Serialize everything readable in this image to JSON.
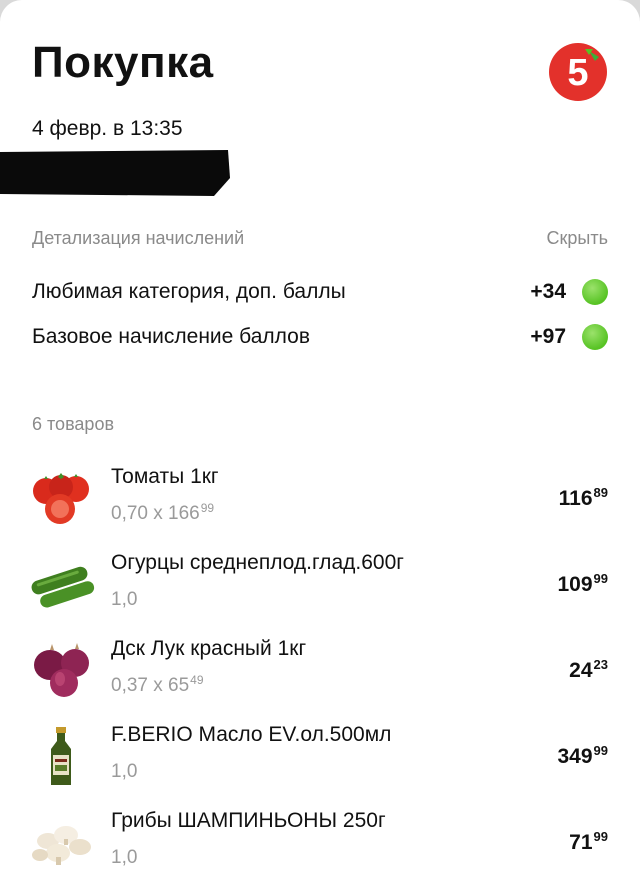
{
  "header": {
    "title": "Покупка",
    "date": "4 февр. в 13:35",
    "logo_text": "5"
  },
  "bonus_details": {
    "heading": "Детализация начислений",
    "hide_label": "Скрыть",
    "rows": [
      {
        "label": "Любимая категория, доп. баллы",
        "points": "+34"
      },
      {
        "label": "Базовое начисление баллов",
        "points": "+97"
      }
    ]
  },
  "items_count": "6 товаров",
  "items": [
    {
      "name": "Томаты 1кг",
      "qty_main": "0,70 х 166",
      "qty_sup": "99",
      "price_main": "116",
      "price_sup": "89",
      "icon": "tomato-icon"
    },
    {
      "name": "Огурцы среднеплод.глад.600г",
      "qty_main": "1,0",
      "qty_sup": "",
      "price_main": "109",
      "price_sup": "99",
      "icon": "cucumber-icon"
    },
    {
      "name": "Дск Лук красный 1кг",
      "qty_main": "0,37 х 65",
      "qty_sup": "49",
      "price_main": "24",
      "price_sup": "23",
      "icon": "red-onion-icon"
    },
    {
      "name": "F.BERIO Масло EV.ол.500мл",
      "qty_main": "1,0",
      "qty_sup": "",
      "price_main": "349",
      "price_sup": "99",
      "icon": "olive-oil-bottle-icon"
    },
    {
      "name": "Грибы ШАМПИНЬОНЫ 250г",
      "qty_main": "1,0",
      "qty_sup": "",
      "price_main": "71",
      "price_sup": "99",
      "icon": "mushrooms-icon"
    }
  ],
  "colors": {
    "logo_red": "#e3312b",
    "bonus_dot": "#57c324",
    "muted_text": "#8a8a8a"
  }
}
